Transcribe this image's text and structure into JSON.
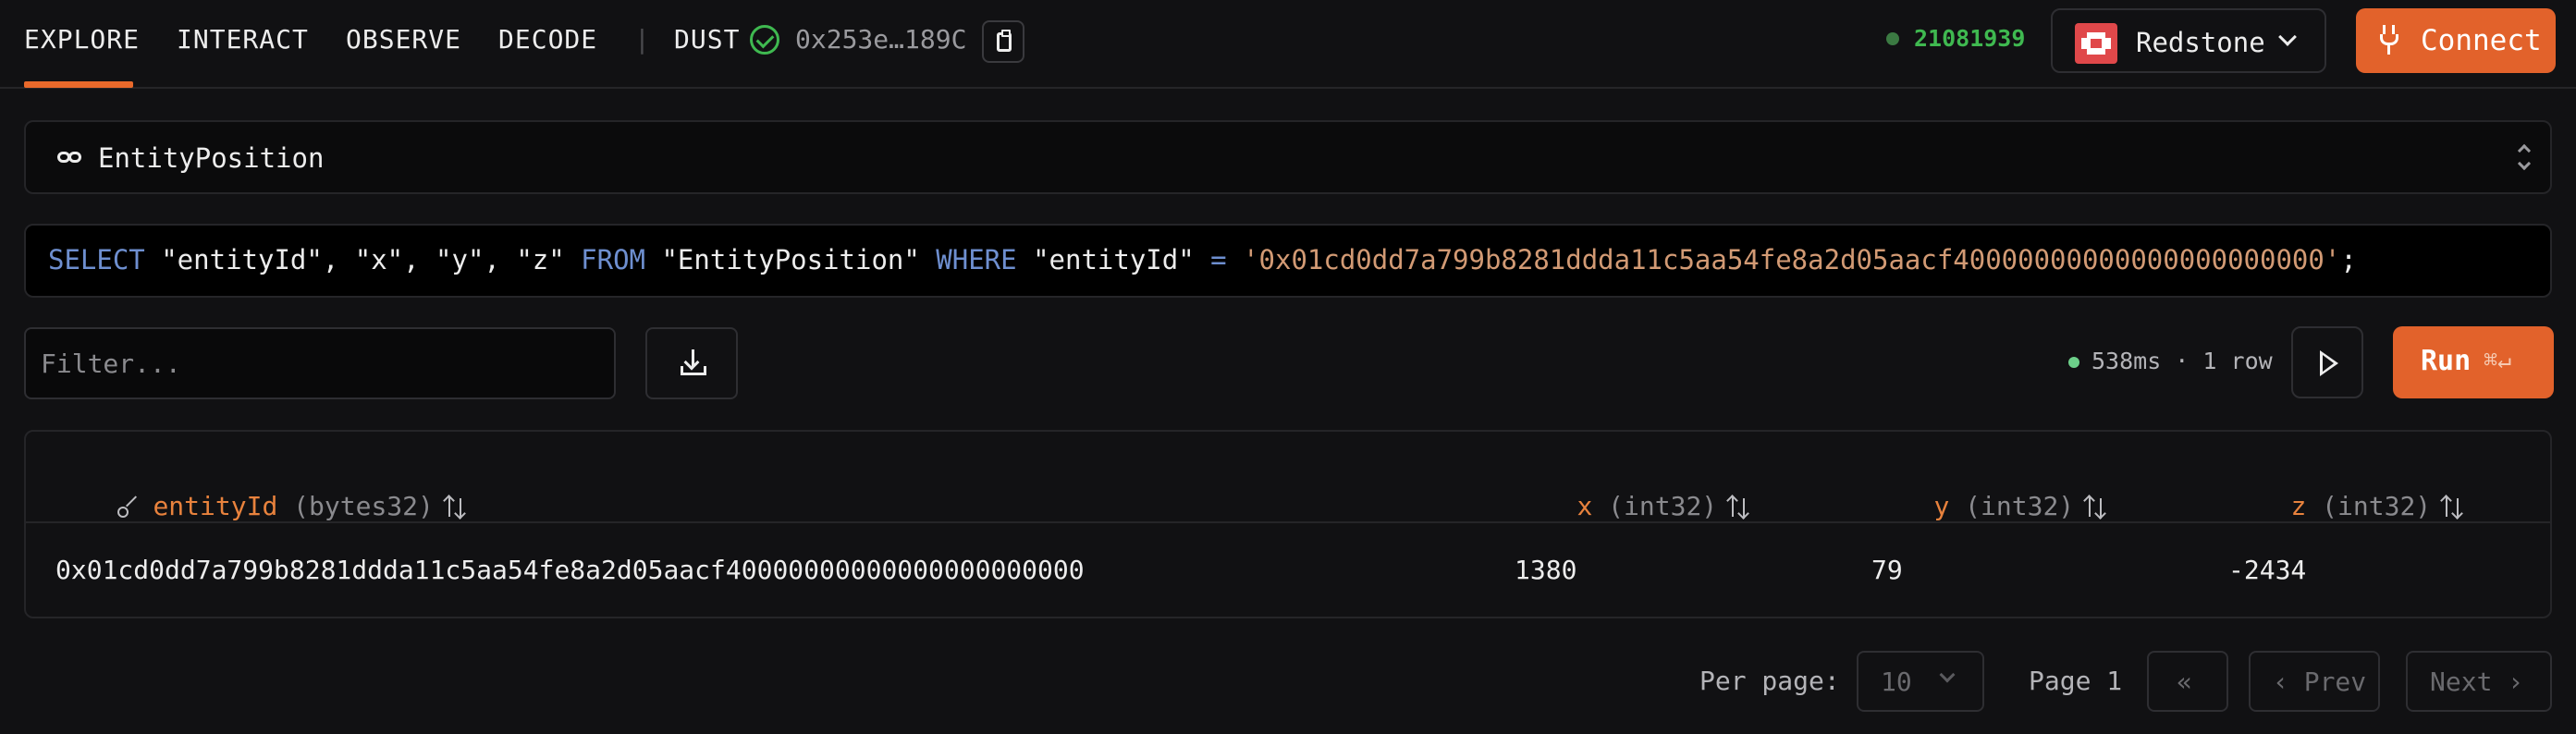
{
  "nav": {
    "tabs": [
      {
        "label": "EXPLORE",
        "active": true
      },
      {
        "label": "INTERACT"
      },
      {
        "label": "OBSERVE"
      },
      {
        "label": "DECODE"
      }
    ],
    "separator": "|",
    "world_name": "DUST",
    "world_address": "0x253e…189C",
    "block_number": "21081939",
    "chain": "Redstone",
    "connect_label": "Connect"
  },
  "table_selector": {
    "value": "EntityPosition"
  },
  "query": {
    "parts": [
      {
        "t": "SELECT",
        "kw": true
      },
      {
        "t": " \"entityId\", \"x\", \"y\", \"z\" "
      },
      {
        "t": "FROM",
        "kw": true
      },
      {
        "t": " \"EntityPosition\" "
      },
      {
        "t": "WHERE",
        "kw": true
      },
      {
        "t": " \"entityId\" "
      },
      {
        "t": "=",
        "kw": true
      },
      {
        "t": " "
      },
      {
        "t": "'0x01cd0dd7a799b8281ddda11c5aa54fe8a2d05aacf40000000000000000000000'",
        "str": true
      },
      {
        "t": ";"
      }
    ]
  },
  "filter": {
    "placeholder": "Filter..."
  },
  "status": {
    "text": "538ms · 1 row"
  },
  "run": {
    "label": "Run",
    "shortcut": "⌘↵"
  },
  "results": {
    "columns": [
      {
        "name": "entityId",
        "type": "(bytes32)"
      },
      {
        "name": "x",
        "type": "(int32)"
      },
      {
        "name": "y",
        "type": "(int32)"
      },
      {
        "name": "z",
        "type": "(int32)"
      }
    ],
    "rows": [
      [
        "0x01cd0dd7a799b8281ddda11c5aa54fe8a2d05aacf40000000000000000000000",
        "1380",
        "79",
        "-2434"
      ]
    ]
  },
  "pagination": {
    "per_page_label": "Per page:",
    "per_page_value": "10",
    "page_label": "Page 1",
    "first_label": "«",
    "prev_label": "‹ Prev",
    "next_label": "Next ›"
  },
  "colors": {
    "accent": "#e2622b",
    "success": "#3fb950",
    "keyword": "#6e8fd0",
    "string": "#d29a74"
  }
}
